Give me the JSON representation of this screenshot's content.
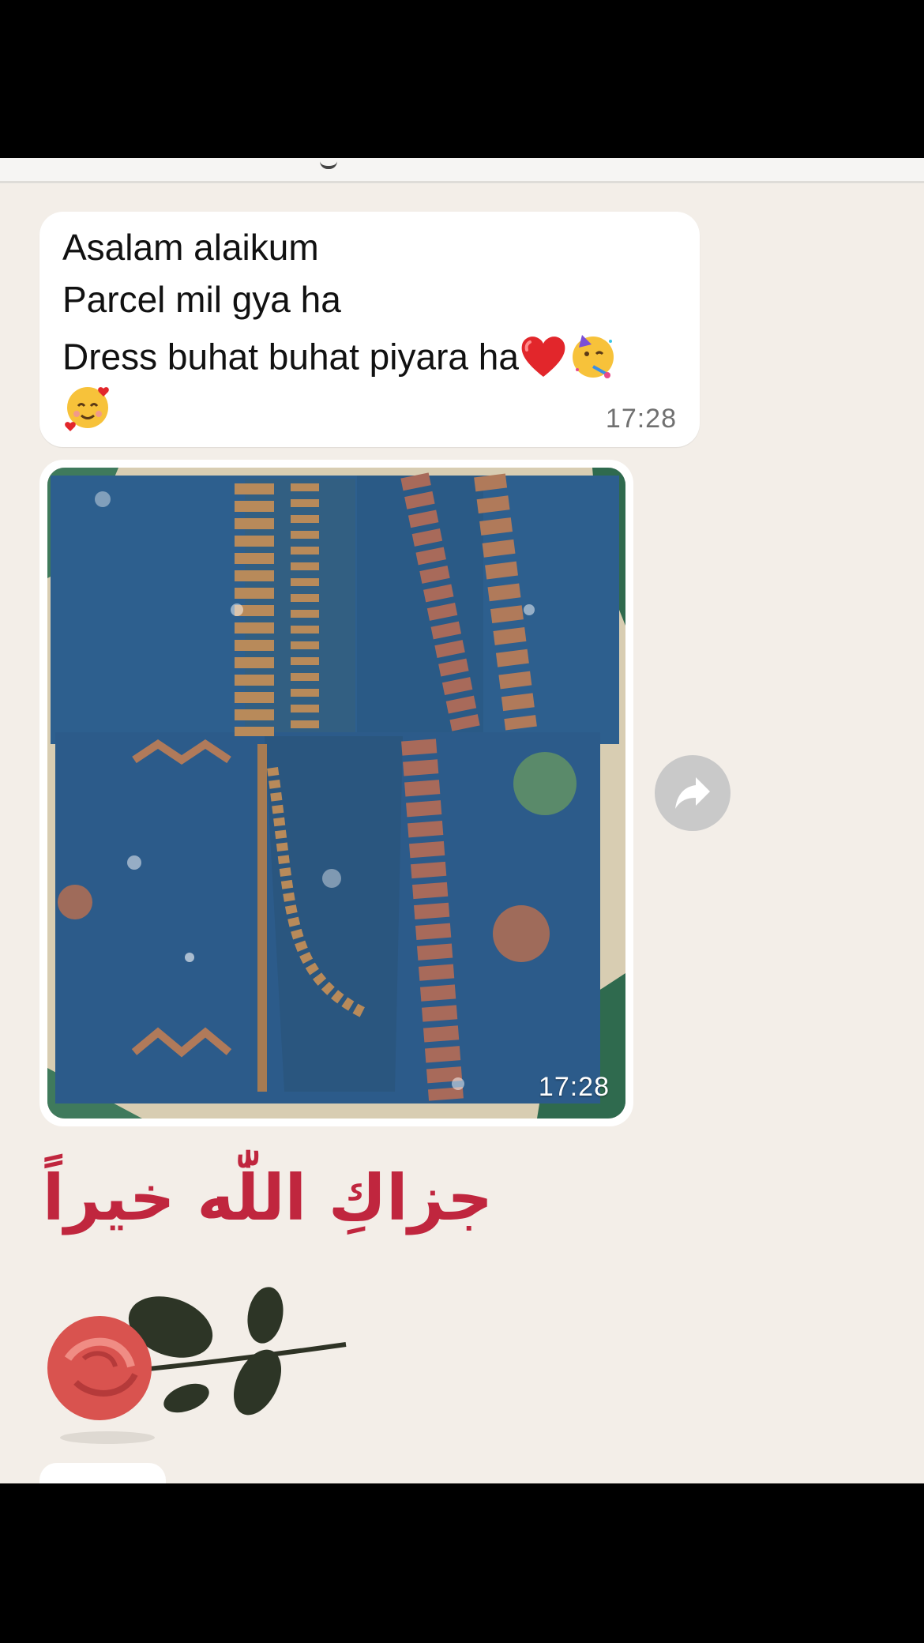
{
  "messages": [
    {
      "type": "text",
      "lines": [
        "Asalam alaikum",
        "Parcel mil gya ha",
        "Dress buhat buhat piyara ha",
        ""
      ],
      "emojis": [
        "red-heart",
        "party-face",
        "smiling-face-with-hearts"
      ],
      "time": "17:28"
    },
    {
      "type": "image",
      "description_icon": "photo-embroidered-dress",
      "time": "17:28"
    },
    {
      "type": "sticker",
      "text": "جزاكِ اللّٰه خيراً",
      "icon": "rose-icon"
    }
  ],
  "colors": {
    "chat_background": "#f3eee8",
    "bubble": "#ffffff",
    "sticker_text": "#c0263e",
    "fabric": "#2f5a84"
  }
}
